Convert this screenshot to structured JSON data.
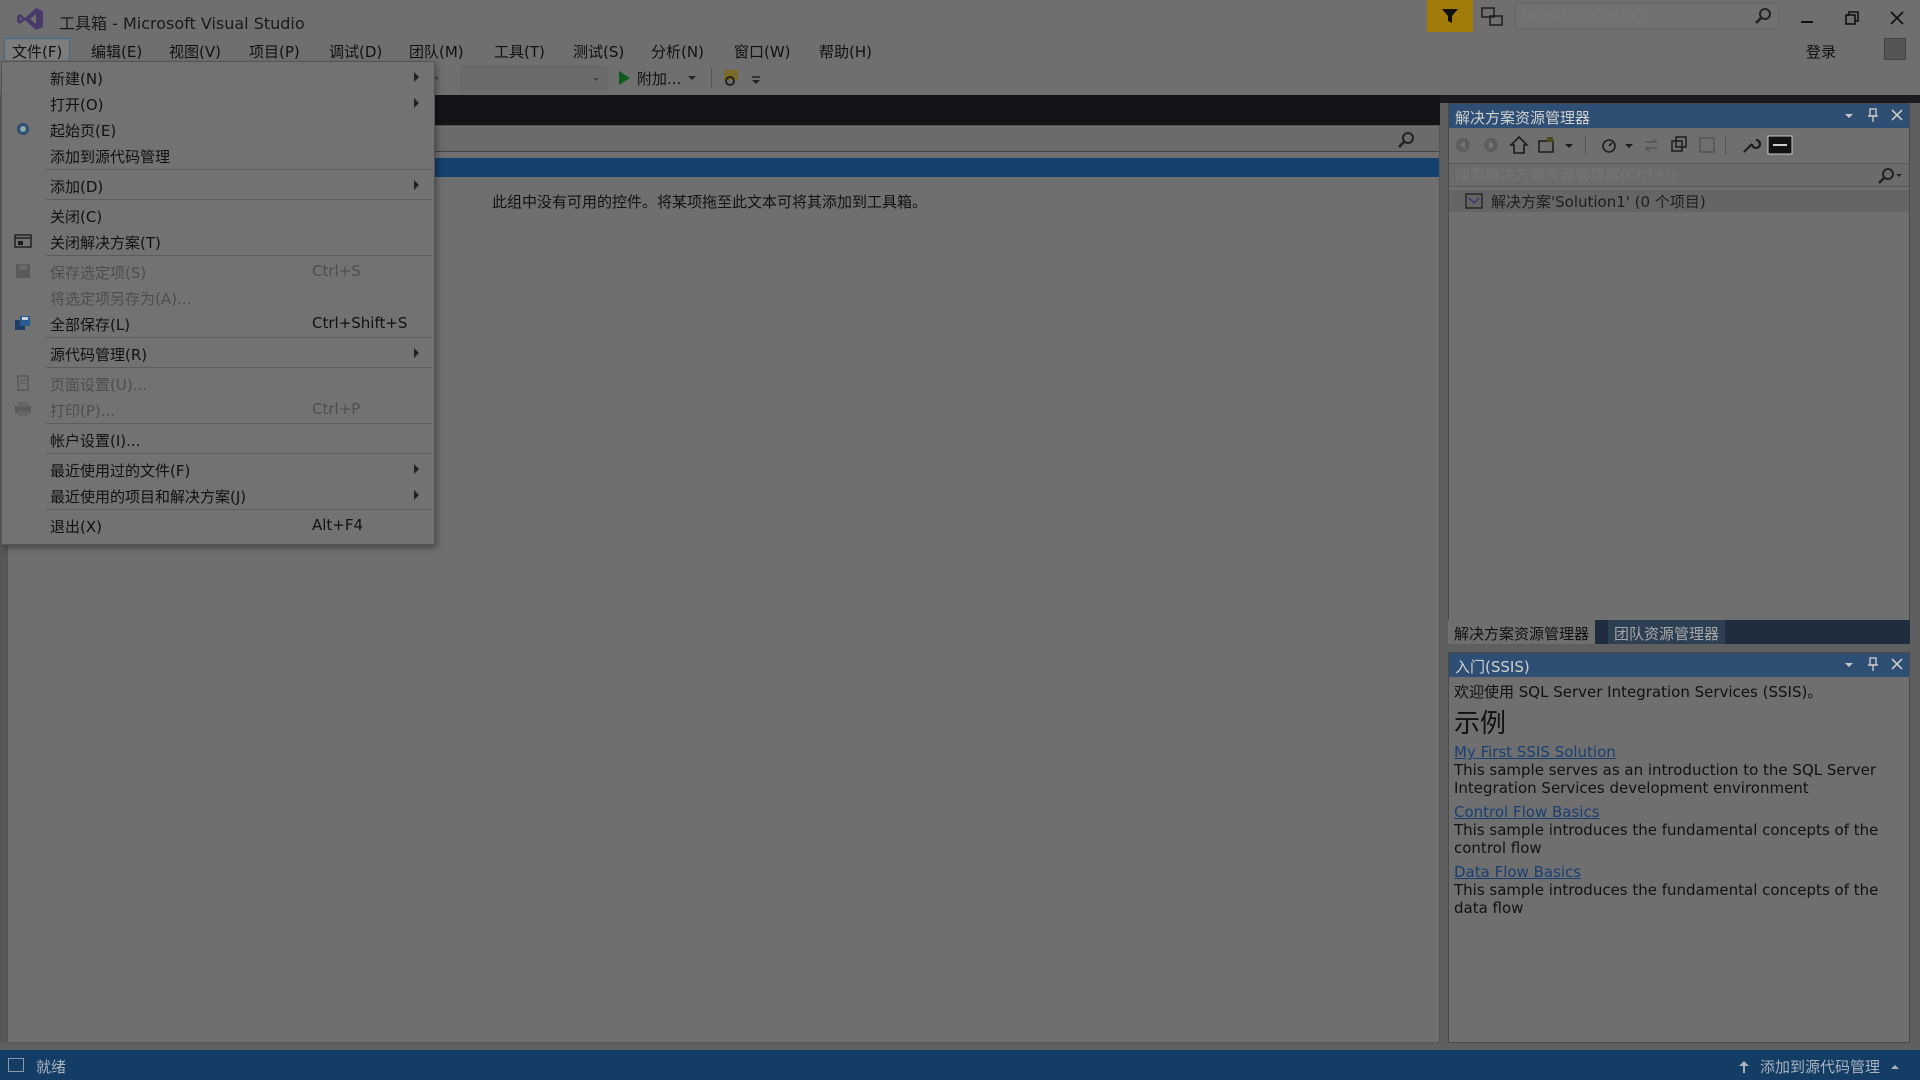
{
  "window": {
    "title": "工具箱 - Microsoft Visual Studio",
    "quick_launch_placeholder": "快速启动 (Ctrl+Q)",
    "login_label": "登录"
  },
  "menubar": {
    "items": [
      "文件(F)",
      "编辑(E)",
      "视图(V)",
      "项目(P)",
      "调试(D)",
      "团队(M)",
      "工具(T)",
      "测试(S)",
      "分析(N)",
      "窗口(W)",
      "帮助(H)"
    ]
  },
  "toolbar": {
    "run_label": "附加..."
  },
  "file_menu": {
    "items": [
      {
        "label": "新建(N)",
        "shortcut": "",
        "submenu": true,
        "enabled": true,
        "icon": ""
      },
      {
        "label": "打开(O)",
        "shortcut": "",
        "submenu": true,
        "enabled": true,
        "icon": ""
      },
      {
        "label": "起始页(E)",
        "shortcut": "",
        "submenu": false,
        "enabled": true,
        "icon": "start-page-icon"
      },
      {
        "label": "添加到源代码管理",
        "shortcut": "",
        "submenu": false,
        "enabled": true,
        "icon": ""
      },
      {
        "label": "添加(D)",
        "shortcut": "",
        "submenu": true,
        "enabled": true,
        "icon": ""
      },
      {
        "label": "关闭(C)",
        "shortcut": "",
        "submenu": false,
        "enabled": true,
        "icon": ""
      },
      {
        "label": "关闭解决方案(T)",
        "shortcut": "",
        "submenu": false,
        "enabled": true,
        "icon": "close-solution-icon"
      },
      {
        "label": "保存选定项(S)",
        "shortcut": "Ctrl+S",
        "submenu": false,
        "enabled": false,
        "icon": "save-icon"
      },
      {
        "label": "将选定项另存为(A)...",
        "shortcut": "",
        "submenu": false,
        "enabled": false,
        "icon": ""
      },
      {
        "label": "全部保存(L)",
        "shortcut": "Ctrl+Shift+S",
        "submenu": false,
        "enabled": true,
        "icon": "save-all-icon"
      },
      {
        "label": "源代码管理(R)",
        "shortcut": "",
        "submenu": true,
        "enabled": true,
        "icon": ""
      },
      {
        "label": "页面设置(U)...",
        "shortcut": "",
        "submenu": false,
        "enabled": false,
        "icon": "page-setup-icon"
      },
      {
        "label": "打印(P)...",
        "shortcut": "Ctrl+P",
        "submenu": false,
        "enabled": false,
        "icon": "print-icon"
      },
      {
        "label": "帐户设置(I)...",
        "shortcut": "",
        "submenu": false,
        "enabled": true,
        "icon": ""
      },
      {
        "label": "最近使用过的文件(F)",
        "shortcut": "",
        "submenu": true,
        "enabled": true,
        "icon": ""
      },
      {
        "label": "最近使用的项目和解决方案(J)",
        "shortcut": "",
        "submenu": true,
        "enabled": true,
        "icon": ""
      },
      {
        "label": "退出(X)",
        "shortcut": "Alt+F4",
        "submenu": false,
        "enabled": true,
        "icon": ""
      }
    ]
  },
  "toolbox": {
    "empty_message": "此组中没有可用的控件。将某项拖至此文本可将其添加到工具箱。"
  },
  "solution_explorer": {
    "title": "解决方案资源管理器",
    "search_placeholder": "搜索解决方案资源管理器(Ctrl+;)",
    "tree_root": "解决方案'Solution1' (0 个项目)",
    "tabs": [
      "解决方案资源管理器",
      "团队资源管理器"
    ]
  },
  "ssis": {
    "title": "入门(SSIS)",
    "welcome": "欢迎使用 SQL Server Integration Services (SSIS)。",
    "heading": "示例",
    "samples": [
      {
        "link": "My First SSIS Solution",
        "desc": "This sample serves as an introduction to the SQL Server Integration Services development environment"
      },
      {
        "link": "Control Flow Basics",
        "desc": "This sample introduces the fundamental concepts of the control flow"
      },
      {
        "link": "Data Flow Basics",
        "desc": "This sample introduces the fundamental concepts of the data flow"
      }
    ]
  },
  "statusbar": {
    "status": "就绪",
    "source_control": "添加到源代码管理"
  },
  "colors": {
    "accent_blue": "#14406d",
    "filter_button": "#a17c08",
    "panel_title": "#2e4f73"
  }
}
